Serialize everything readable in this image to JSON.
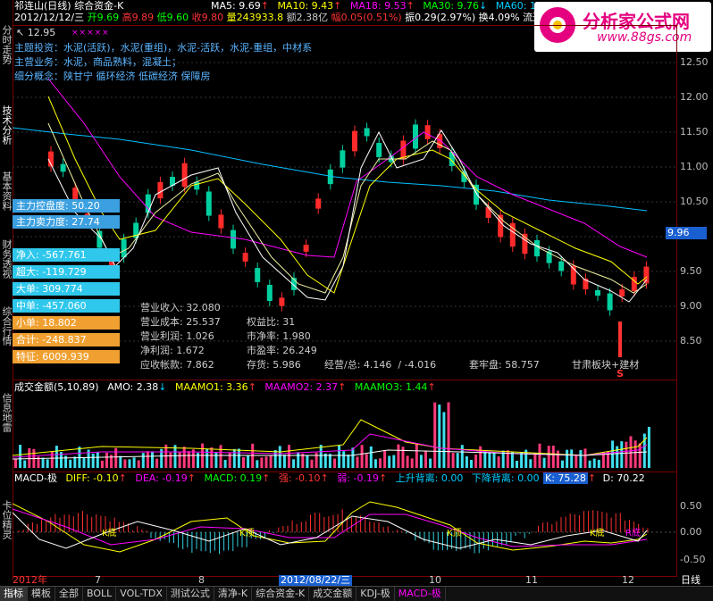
{
  "header": {
    "row1": {
      "name": "祁连山(日线)",
      "mode": "综合资金-K",
      "ma5": "MA5: 9.69",
      "ma10": "MA10: 9.43",
      "ma18": "MA18: 9.53",
      "ma30": "MA30: 9.76",
      "ma60": "MA60: 10.3",
      "ma5_arrow": "↑",
      "ma10_arrow": "↑",
      "ma18_arrow": "↑",
      "ma30_arrow": "↓"
    },
    "row2": {
      "date": "2012/12/12/三",
      "open": "开9.69",
      "high": "高9.89",
      "low": "低9.60",
      "close": "收9.80",
      "volume": "量243933.8",
      "amount": "额2.38亿",
      "change": "幅0.05(0.51%)",
      "amplitude": "振0.29(2.97%)",
      "turnover": "换4.09%",
      "float": "流通"
    },
    "top_price": "12.95",
    "xx_marks": "×××××"
  },
  "info": {
    "hot": "主题投资：水泥(活跃)，水泥(重组)，水泥-活跃，水泥-重组，中材系",
    "business": "主营业务：水泥，商品熟料，混凝土；",
    "concept": "细分概念：陕甘宁 循环经济 低碳经济 保障房"
  },
  "left_labels": [
    {
      "text": "主力控盘度: 50.20",
      "bg": "#3ca0e0"
    },
    {
      "text": "主力卖力度: 27.74",
      "bg": "#3ca0e0"
    },
    {
      "text": "",
      "bg": "#000000"
    },
    {
      "text": "净入: -567.761",
      "bg": "#2fc8ec"
    },
    {
      "text": "超大: -119.729",
      "bg": "#2fc8ec"
    },
    {
      "text": "大单: 309.774",
      "bg": "#2fc8ec"
    },
    {
      "text": "中单: -457.060",
      "bg": "#2fc8ec"
    },
    {
      "text": "小单: 18.802",
      "bg": "#f0a030"
    },
    {
      "text": "合计: -248.837",
      "bg": "#f0a030"
    },
    {
      "text": "特征: 6009.939",
      "bg": "#f0a030"
    }
  ],
  "financials": [
    {
      "label": "营业收入:",
      "value": "32.080"
    },
    {
      "label": "营业成本:",
      "value": "25.537"
    },
    {
      "label": "营业利润:",
      "value": "1.026"
    },
    {
      "label": "净利润:",
      "value": "1.672"
    },
    {
      "label": "应收帐款:",
      "value": "7.862"
    }
  ],
  "financials2": [
    {
      "label": "权益比:",
      "value": "31"
    },
    {
      "label": "市净率:",
      "value": "1.980"
    },
    {
      "label": "市盈率:",
      "value": "26.249"
    },
    {
      "label": "存货:",
      "value": "5.986"
    }
  ],
  "bottom_info": {
    "operating": "经营/总: 4.146",
    "ratio": "/ -4.016",
    "lock": "套牢盘: 58.757",
    "region": "甘肃板块+建材",
    "s_mark": "S"
  },
  "price_axis": [
    "12.50",
    "12.00",
    "11.50",
    "11.00",
    "10.50",
    "10.00",
    "9.50",
    "9.00",
    "8.50"
  ],
  "current_price": "9.96",
  "volume_panel": {
    "title": "成交金额(5,10,89)",
    "amo": "AMO: 2.38",
    "amo_arrow": "↓",
    "maamo1": "MAAMO1: 3.36",
    "maamo1_arrow": "↑",
    "maamo2": "MAAMO2: 2.37",
    "maamo2_arrow": "↑",
    "maamo3": "MAAMO3: 1.44",
    "maamo3_arrow": "↑"
  },
  "macd_panel": {
    "title": "MACD-极",
    "diff": "DIFF: -0.10",
    "diff_arrow": "↑",
    "dea": "DEA: -0.19",
    "dea_arrow": "↑",
    "macd": "MACD: 0.19",
    "macd_arrow": "↑",
    "strong": "强: -0.10",
    "strong_arrow": "↑",
    "weak": "弱: -0.19",
    "weak_arrow": "↑",
    "up_div": "上升背离: 0.00",
    "down_div": "下降背离: 0.00",
    "k": "K: 75.28",
    "k_arrow": "↑",
    "d": "D: 70.22",
    "axis": [
      "0.50",
      "0.00",
      "-0.50"
    ],
    "marks": [
      "K底",
      "K顶",
      "K顶",
      "K底",
      "R底"
    ]
  },
  "date_axis": {
    "labels": [
      "2012年",
      "7",
      "8",
      "2012/08/22/三",
      "10",
      "11",
      "12"
    ],
    "period": "日线"
  },
  "bottom_tabs": [
    "指标",
    "模板",
    "全部",
    "BOLL",
    "VOL-TDX",
    "测试公式",
    "清净-K",
    "综合资金-K",
    "成交金额",
    "KDJ-极",
    "MACD-极"
  ],
  "sidebar_tabs": [
    "分时走势",
    "技术分析",
    "基本资料",
    "财务透视",
    "综合行情",
    "信息地雷",
    "卡位精灵"
  ],
  "logo": {
    "name": "分析家公式网",
    "url": "www.88gs.com"
  },
  "colors": {
    "up": "#ff2a2a",
    "down": "#00d0d0",
    "ma5": "#ffffff",
    "ma10": "#ffff00",
    "ma18": "#ff00ff",
    "ma30": "#00ff00",
    "ma60": "#00c0ff"
  }
}
